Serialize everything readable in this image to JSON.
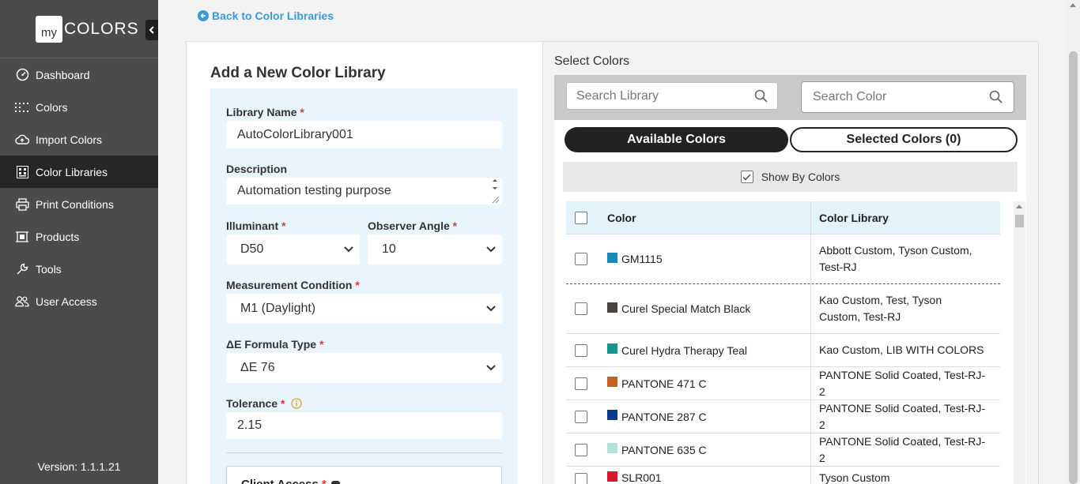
{
  "brand": {
    "prefix": "my",
    "name": "COLORS"
  },
  "nav": [
    {
      "label": "Dashboard",
      "icon": "dashboard-icon"
    },
    {
      "label": "Colors",
      "icon": "grid-dots-icon"
    },
    {
      "label": "Import Colors",
      "icon": "cloud-upload-icon"
    },
    {
      "label": "Color Libraries",
      "icon": "library-icon",
      "active": true
    },
    {
      "label": "Print Conditions",
      "icon": "printer-icon"
    },
    {
      "label": "Products",
      "icon": "product-icon"
    },
    {
      "label": "Tools",
      "icon": "wrench-icon"
    },
    {
      "label": "User Access",
      "icon": "users-icon"
    }
  ],
  "version": "Version: 1.1.1.21",
  "back_link": "Back to Color Libraries",
  "form": {
    "title": "Add a New Color Library",
    "library_name_label": "Library Name",
    "library_name_value": "AutoColorLibrary001",
    "description_label": "Description",
    "description_value": "Automation testing purpose",
    "illuminant_label": "Illuminant",
    "illuminant_value": "D50",
    "observer_label": "Observer Angle",
    "observer_value": "10",
    "measurement_label": "Measurement Condition",
    "measurement_value": "M1 (Daylight)",
    "formula_label": "ΔE Formula Type",
    "formula_value": "ΔE 76",
    "tolerance_label": "Tolerance",
    "tolerance_value": "2.15",
    "client_access_label": "Client Access",
    "required_mark": "*"
  },
  "select_colors": {
    "title": "Select Colors",
    "search_library_placeholder": "Search Library",
    "search_color_placeholder": "Search Color",
    "tab_available": "Available Colors",
    "tab_selected": "Selected Colors (0)",
    "show_by_colors": "Show By Colors",
    "col_color": "Color",
    "col_library": "Color Library",
    "rows": [
      {
        "name": "GM1115",
        "swatch": "#1a87b8",
        "libraries": "Abbott Custom, Tyson Custom, Test-RJ"
      },
      {
        "name": "Curel Special Match Black",
        "swatch": "#4a4440",
        "libraries": "Kao Custom, Test, Tyson Custom, Test-RJ"
      },
      {
        "name": "Curel Hydra Therapy Teal",
        "swatch": "#16958a",
        "libraries": "Kao Custom, LIB WITH COLORS"
      },
      {
        "name": "PANTONE 471 C",
        "swatch": "#c5621e",
        "libraries": "PANTONE Solid Coated, Test-RJ-2"
      },
      {
        "name": "PANTONE 287 C",
        "swatch": "#0b3a8c",
        "libraries": "PANTONE Solid Coated, Test-RJ-2"
      },
      {
        "name": "PANTONE 635 C",
        "swatch": "#b5e1dd",
        "libraries": "PANTONE Solid Coated, Test-RJ-2"
      },
      {
        "name": "SLR001",
        "swatch": "#d8192b",
        "libraries": "Tyson Custom"
      }
    ]
  }
}
